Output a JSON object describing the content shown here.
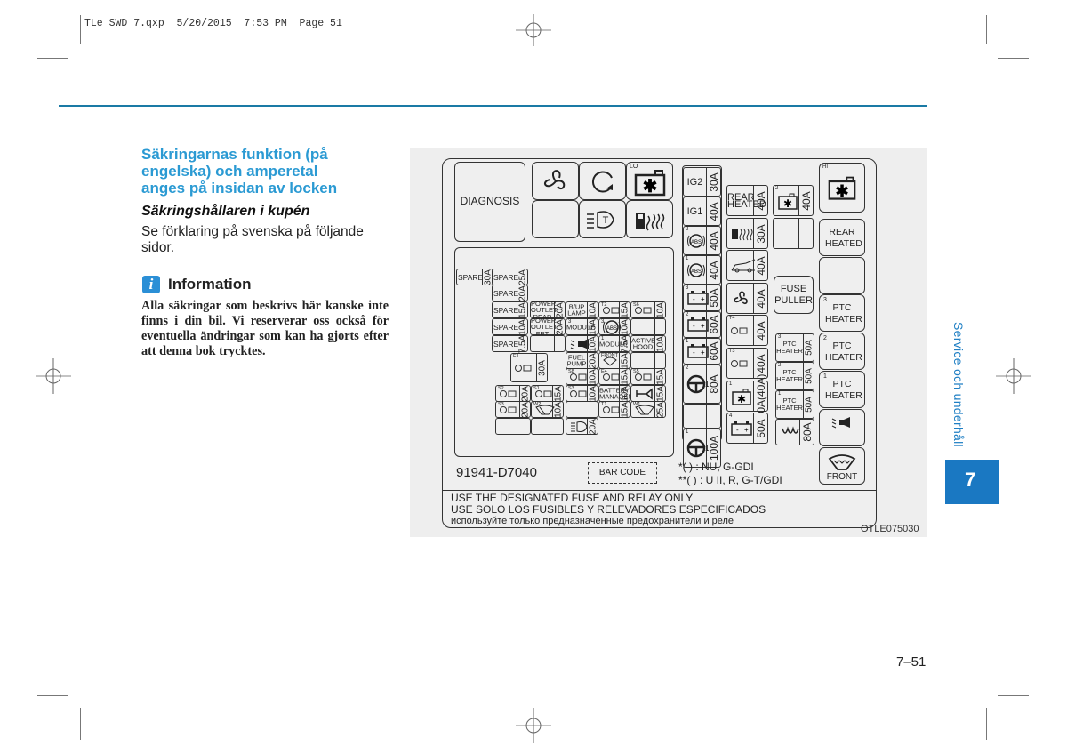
{
  "slug": "TLe SWD 7.qxp  5/20/2015  7:53 PM  Page 51",
  "left_column": {
    "heading_lines": [
      "Säkringarnas funktion (på",
      "engelska) och amperetal",
      "anges på insidan av locken"
    ],
    "subheading": "Säkringshållaren i kupén",
    "body": "Se förklaring på svenska på följande sidor.",
    "info": {
      "icon": "info-icon",
      "icon_glyph": "i",
      "title": "Information",
      "body": "Alla säkringar som beskrivs här kanske inte finns i din bil. Vi reserverar oss också för eventuella ändringar som kan ha gjorts efter att denna bok trycktes."
    }
  },
  "figure": {
    "caption_code": "OTLE075030",
    "part_number": "91941-D7040",
    "bar_code_label": "BAR CODE",
    "notes": [
      "*( ) : NU, G-GDI",
      "**( ) : U II, R, G-T/GDI"
    ],
    "warnings": [
      "USE THE DESIGNATED FUSE AND RELAY ONLY",
      "USE SOLO LOS FUSIBLES Y RELEVADORES ESPECIFICADOS",
      "используйте только предназначенные предохранители и реле"
    ],
    "top_relays": {
      "diagnosis": "DIAGNOSIS",
      "icons": [
        "fan-icon",
        "recirculation-icon",
        "defroster-lo-icon",
        "empty",
        "headlamp-level-icon",
        "fuel-heater-icon"
      ],
      "lo_label": "LO"
    },
    "mini_fuses": {
      "spare": [
        {
          "label": "SPARE",
          "amp": "30A"
        },
        {
          "label": "SPARE",
          "amp": "25A"
        },
        {
          "label": "SPARE",
          "amp": "20A"
        },
        {
          "label": "SPARE",
          "amp": "15A"
        },
        {
          "label": "SPARE",
          "amp": "10A"
        },
        {
          "label": "SPARE",
          "amp": "7.5A"
        }
      ],
      "grid": [
        {
          "label": "POWER OUTLET REAR",
          "amp": "20A"
        },
        {
          "label": "B/UP LAMP",
          "amp": "10A"
        },
        {
          "label": "T2",
          "amp": "15A",
          "icon": "engine-icon"
        },
        {
          "label": "S6",
          "amp": "10A",
          "icon": "engine-icon"
        },
        {
          "label": "POWER OUTLET FRT",
          "amp": "20A"
        },
        {
          "label": "MODULE",
          "sup": "3",
          "amp": "15A"
        },
        {
          "label": "ABS",
          "sup": "3",
          "amp": "10A",
          "icon": "abs-icon"
        },
        {
          "label": "",
          "amp": ""
        },
        {
          "label": "",
          "amp": ""
        },
        {
          "label": "",
          "amp": "10A",
          "icon": "horn-speaker-icon"
        },
        {
          "label": "MODULE",
          "sup": "1",
          "amp": "7.5A"
        },
        {
          "label": "ACTIVE HOOD",
          "amp": "10A"
        },
        {
          "label": "E1",
          "amp": "30A",
          "icon": "engine-icon"
        },
        {
          "label": "FUEL PUMP",
          "amp": "20A"
        },
        {
          "label": "FRONT",
          "amp": "15A",
          "icon": "washer-icon"
        },
        {
          "label": "",
          "amp": ""
        },
        {
          "label": "S8",
          "amp": "10A",
          "icon": "engine-icon"
        },
        {
          "label": "E4",
          "amp": "15A",
          "icon": "engine-icon"
        },
        {
          "label": "S5",
          "amp": "15A",
          "icon": "engine-icon"
        },
        {
          "label": "S2",
          "amp": "20A",
          "icon": "engine-icon"
        },
        {
          "label": "S1",
          "amp": "15A",
          "icon": "engine-icon"
        },
        {
          "label": "S3",
          "amp": "10A",
          "icon": "engine-icon"
        },
        {
          "label": "BATTERY MANAGEMENT",
          "amp": "10A"
        },
        {
          "label": "",
          "amp": "15A",
          "icon": "horn-icon"
        },
        {
          "label": "S3",
          "amp": "20A",
          "icon": "engine-icon"
        },
        {
          "label": "W2",
          "amp": "10A",
          "icon": "wiper-icon"
        },
        {
          "label": "T1",
          "amp": "15A",
          "icon": "engine-icon"
        },
        {
          "label": "W1",
          "amp": "25A",
          "icon": "wiper-icon"
        },
        {
          "label": "",
          "amp": "20A",
          "icon": "headlamp-level-icon"
        }
      ]
    },
    "multi_fuses": [
      {
        "label": "IG2",
        "amp": "30A"
      },
      {
        "label": "IG1",
        "amp": "40A"
      },
      {
        "label": "ABS",
        "sup": "2",
        "amp": "40A",
        "icon": "abs-icon"
      },
      {
        "label": "ABS",
        "sup": "1",
        "amp": "40A",
        "icon": "abs-icon"
      },
      {
        "label": "",
        "sup": "3",
        "amp": "50A",
        "icon": "battery-icon"
      },
      {
        "label": "",
        "sup": "2",
        "amp": "60A",
        "icon": "battery-icon"
      },
      {
        "label": "",
        "sup": "1",
        "amp": "60A",
        "icon": "battery-icon"
      },
      {
        "label": "",
        "sup": "2",
        "amp": "80A",
        "icon": "steering-icon"
      },
      {
        "label": "",
        "amp": ""
      },
      {
        "label": "",
        "sup": "1",
        "amp": "100A",
        "icon": "steering-icon"
      }
    ],
    "mid_fuses": [
      {
        "label": "REAR HEATED",
        "amp": "40A"
      },
      {
        "label": "",
        "amp": "30A",
        "icon": "fuel-heater-icon"
      },
      {
        "label": "",
        "amp": "40A",
        "icon": "tailgate-icon"
      },
      {
        "label": "",
        "amp": "40A",
        "icon": "fan-icon"
      },
      {
        "label": "T4",
        "amp": "40A",
        "icon": "engine-icon"
      },
      {
        "label": "T3",
        "amp": "40A",
        "icon": "engine-icon"
      },
      {
        "label": "",
        "sup": "1",
        "amp": "50A(40A)",
        "icon": "defroster-icon"
      },
      {
        "label": "",
        "sup": "4",
        "amp": "50A",
        "icon": "battery-icon"
      }
    ],
    "right_mid_fuses": [
      {
        "label": "",
        "sup": "2",
        "amp": "40A",
        "icon": "defroster-icon"
      },
      {
        "label": "",
        "amp": ""
      },
      {
        "label": "FUSE PULLER"
      },
      {
        "label": "PTC HEATER",
        "sup": "3",
        "amp": "50A"
      },
      {
        "label": "PTC HEATER",
        "sup": "2",
        "amp": "50A"
      },
      {
        "label": "PTC HEATER",
        "sup": "1",
        "amp": "50A"
      },
      {
        "label": "",
        "amp": "80A",
        "icon": "glow-plug-icon"
      }
    ],
    "right_relays": [
      {
        "label": "HI",
        "icon": "defroster-hi-icon"
      },
      {
        "label": "REAR HEATED"
      },
      {
        "label": ""
      },
      {
        "label": "PTC HEATER",
        "sup": "3"
      },
      {
        "label": "PTC HEATER",
        "sup": "2"
      },
      {
        "label": "PTC HEATER",
        "sup": "1"
      },
      {
        "label": "",
        "icon": "horn-speaker-icon"
      },
      {
        "label": "FRONT",
        "icon": "wiper-washer-icon"
      }
    ]
  },
  "side_tab": {
    "chapter_title": "Service och underhåll",
    "chapter_number": "7"
  },
  "page_number": "7–51",
  "colors": {
    "accent_blue": "#2b9ad3",
    "tab_blue": "#1a78c2",
    "rule_blue": "#1a7aa5"
  }
}
